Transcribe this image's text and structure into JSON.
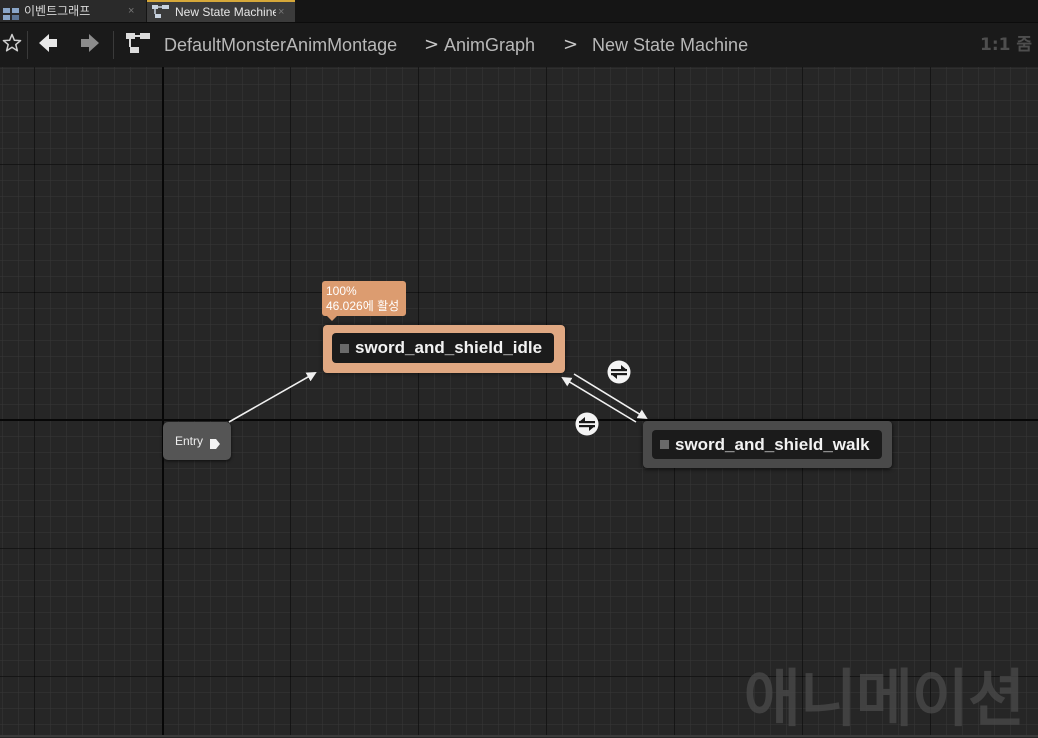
{
  "tabs": [
    {
      "label": "이벤트그래프",
      "close": "×",
      "icon": "event-graph-icon",
      "active": false
    },
    {
      "label": "New State Machine",
      "close": "×",
      "icon": "state-machine-icon",
      "active": true
    }
  ],
  "breadcrumb": {
    "items": [
      "DefaultMonsterAnimMontage",
      "AnimGraph",
      "New State Machine"
    ],
    "separator": ">"
  },
  "zoom": "1:1 줌",
  "graph": {
    "entry": {
      "label": "Entry"
    },
    "states": [
      {
        "name": "sword_and_shield_idle",
        "active": true
      },
      {
        "name": "sword_and_shield_walk",
        "active": false
      }
    ],
    "active_tooltip": {
      "percent": "100%",
      "time": "46.026에 활성"
    },
    "transitions": [
      {
        "from": "sword_and_shield_idle",
        "to": "sword_and_shield_walk",
        "icon": "transition-rule-icon"
      },
      {
        "from": "sword_and_shield_walk",
        "to": "sword_and_shield_idle",
        "icon": "transition-rule-icon"
      }
    ]
  },
  "watermark": "애니메이션",
  "colors": {
    "active_state": "#e0a882",
    "inactive_state": "#4a4a4a",
    "tab_accent": "#d6a83a",
    "canvas": "#262626"
  }
}
